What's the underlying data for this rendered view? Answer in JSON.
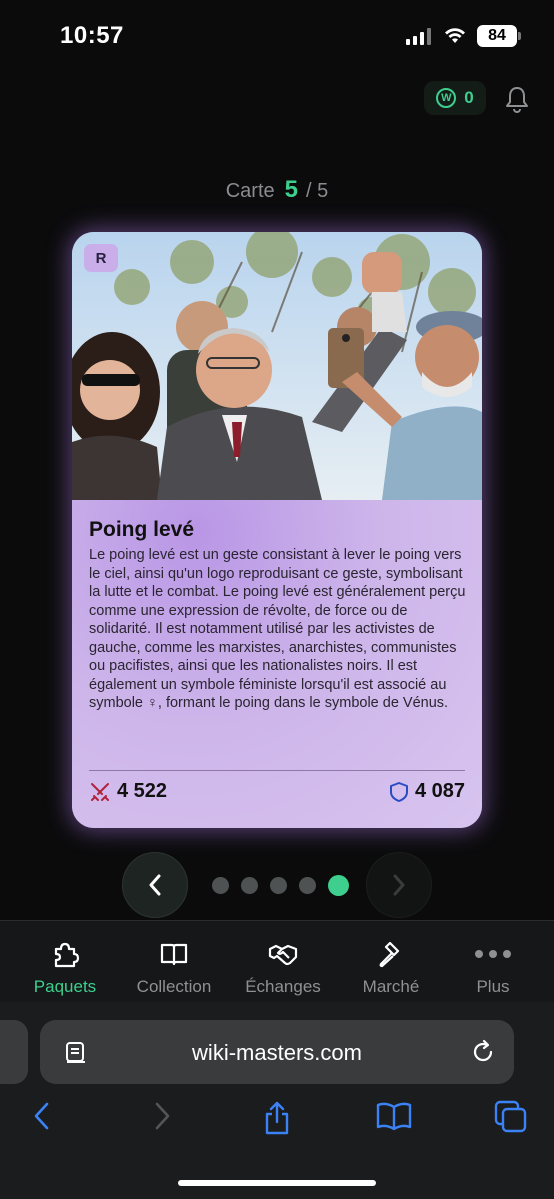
{
  "status_bar": {
    "time": "10:57",
    "battery": "84"
  },
  "header": {
    "wiki_points": "0",
    "wiki_icon_letter": "W"
  },
  "counter": {
    "label": "Carte",
    "current": "5",
    "total": "/ 5"
  },
  "card": {
    "rarity": "R",
    "title": "Poing levé",
    "description": "Le poing levé est un geste consistant à lever le poing vers le ciel, ainsi qu'un logo reproduisant ce geste, symbolisant la lutte et le combat. Le poing levé est généralement perçu comme une expression de révolte, de force ou de solidarité. Il est notamment utilisé par les activistes de gauche, comme les marxistes, anarchistes, communistes ou pacifistes, ainsi que les nationalistes noirs. Il est également un symbole féministe lorsqu'il est associé au symbole ♀, formant le poing dans le symbole de Vénus.",
    "attack": "4 522",
    "defense": "4 087",
    "image_icon": "photo-people-crowd"
  },
  "pagination": {
    "current_index": 5,
    "total": 5
  },
  "bottom_nav": {
    "items": [
      {
        "label": "Paquets",
        "icon": "puzzle-icon",
        "active": true
      },
      {
        "label": "Collection",
        "icon": "book-icon",
        "active": false
      },
      {
        "label": "Échanges",
        "icon": "handshake-icon",
        "active": false
      },
      {
        "label": "Marché",
        "icon": "hammer-icon",
        "active": false
      },
      {
        "label": "Plus",
        "icon": "more-icon",
        "active": false
      }
    ]
  },
  "browser": {
    "url": "wiki-masters.com"
  },
  "colors": {
    "accent": "#3ecf8e",
    "card": "#cdb5ea",
    "background": "#0b0b0c"
  }
}
